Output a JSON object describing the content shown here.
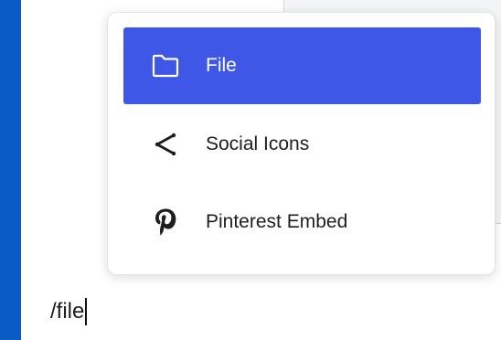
{
  "menu": {
    "items": [
      {
        "label": "File",
        "icon": "folder-icon",
        "active": true
      },
      {
        "label": "Social Icons",
        "icon": "share-icon",
        "active": false
      },
      {
        "label": "Pinterest Embed",
        "icon": "pinterest-icon",
        "active": false
      }
    ]
  },
  "editor": {
    "typed_text": "/file"
  },
  "colors": {
    "sidebar": "#0a5bc4",
    "active_item_bg": "#3f57e6",
    "active_item_text": "#ffffff",
    "text": "#1e1e1e"
  }
}
